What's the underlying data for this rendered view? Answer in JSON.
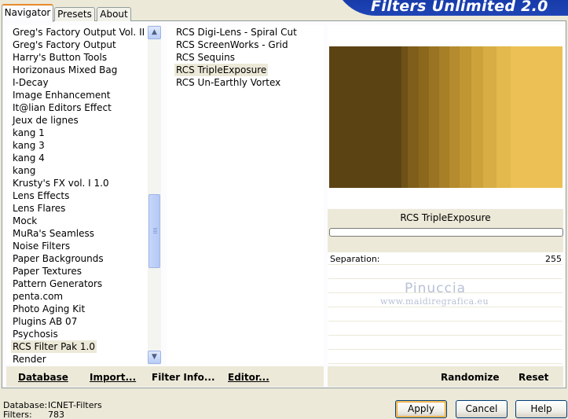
{
  "window": {
    "title": "Filters Unlimited 2.0"
  },
  "tabs": [
    {
      "label": "Navigator",
      "active": true
    },
    {
      "label": "Presets",
      "active": false
    },
    {
      "label": "About",
      "active": false
    }
  ],
  "categories": {
    "items": [
      "Greg's Factory Output Vol. II",
      "Greg's Factory Output",
      "Harry's Button Tools",
      "Horizonaus Mixed Bag",
      "I-Decay",
      "Image Enhancement",
      "It@lian Editors Effect",
      "Jeux de lignes",
      "kang 1",
      "kang 3",
      "kang 4",
      "kang",
      "Krusty's FX vol. I 1.0",
      "Lens Effects",
      "Lens Flares",
      "Mock",
      "MuRa's Seamless",
      "Noise Filters",
      "Paper Backgrounds",
      "Paper Textures",
      "Pattern Generators",
      "penta.com",
      "Photo Aging Kit",
      "Plugins AB 07",
      "Psychosis",
      "RCS Filter Pak 1.0",
      "Render"
    ],
    "selected": "RCS Filter Pak 1.0"
  },
  "filters": {
    "items": [
      "RCS Digi-Lens - Spiral Cut",
      "RCS ScreenWorks - Grid",
      "RCS Sequins",
      "RCS TripleExposure",
      "RCS Un-Earthly Vortex"
    ],
    "selected": "RCS TripleExposure"
  },
  "preview": {
    "colors": [
      "#5c4313",
      "#6e5117",
      "#7e5e1a",
      "#8c681d",
      "#9a7422",
      "#a77f27",
      "#b48b2e",
      "#c09633",
      "#cda23b",
      "#d8ad44",
      "#e3b84c",
      "#ecc054"
    ]
  },
  "filter_panel": {
    "name": "RCS TripleExposure",
    "param_label": "Separation:",
    "param_value": "255",
    "watermark_line1": "Pinuccia",
    "watermark_line2": "www.maidiregrafica.eu"
  },
  "actions": {
    "database": "Database",
    "import": "Import...",
    "filter_info": "Filter Info...",
    "editor": "Editor...",
    "randomize": "Randomize",
    "reset": "Reset"
  },
  "status": {
    "database_label": "Database:",
    "database_value": "ICNET-Filters",
    "filters_label": "Filters:",
    "filters_value": "783"
  },
  "buttons": {
    "apply": "Apply",
    "cancel": "Cancel",
    "help": "Help"
  },
  "scroll_icons": {
    "up": "chevron-up-icon",
    "down": "chevron-down-icon"
  }
}
